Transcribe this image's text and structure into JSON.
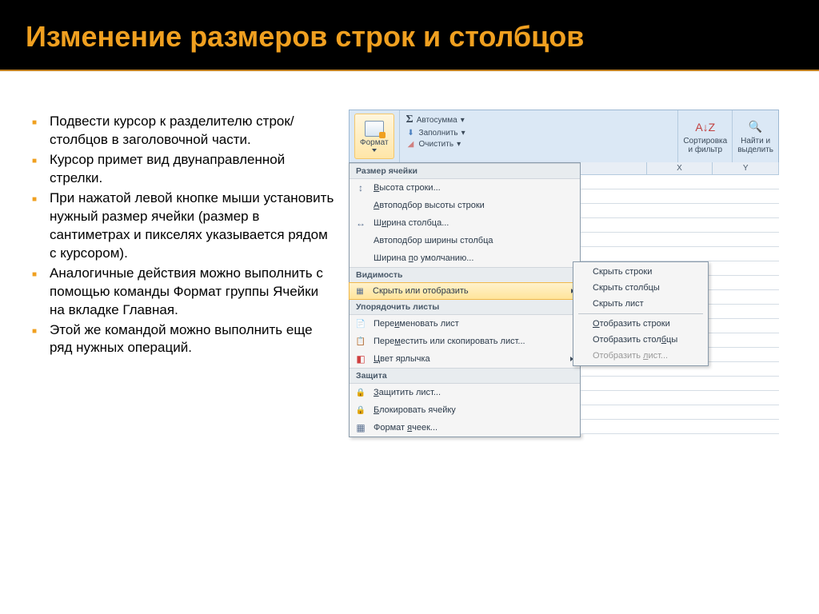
{
  "slide": {
    "title": "Изменение размеров строк и столбцов",
    "bullets": [
      "Подвести курсор к разделителю строк/столбцов в заголовочной части.",
      "Курсор примет вид двунаправленной стрелки.",
      "При нажатой левой кнопке мыши установить нужный размер ячейки (размер в сантиметрах и пикселях указывается рядом с курсором).",
      "Аналогичные действия можно выполнить с помощью команды Формат группы Ячейки на вкладке Главная.",
      "Этой же командой можно выполнить еще ряд нужных операций."
    ]
  },
  "ribbon": {
    "format_label": "Формат",
    "autosum": "Автосумма",
    "fill": "Заполнить",
    "clear": "Очистить",
    "sort_label1": "Сортировка",
    "sort_label2": "и фильтр",
    "find_label1": "Найти и",
    "find_label2": "выделить"
  },
  "menu": {
    "sections": {
      "cell_size": "Размер ячейки",
      "visibility": "Видимость",
      "sheets": "Упорядочить листы",
      "protection": "Защита"
    },
    "items": {
      "row_height": "Высота строки...",
      "auto_row": "Автоподбор высоты строки",
      "col_width": "Ширина столбца...",
      "auto_col": "Автоподбор ширины столбца",
      "default_width": "Ширина по умолчанию...",
      "hide_show": "Скрыть или отобразить",
      "rename": "Переименовать лист",
      "move": "Переместить или скопировать лист...",
      "tab_color": "Цвет ярлычка",
      "protect": "Защитить лист...",
      "lock": "Блокировать ячейку",
      "format_cells": "Формат ячеек..."
    }
  },
  "submenu": {
    "hide_rows": "Скрыть строки",
    "hide_cols": "Скрыть столбцы",
    "hide_sheet": "Скрыть лист",
    "show_rows": "Отобразить строки",
    "show_cols": "Отобразить столбцы",
    "show_sheet": "Отобразить лист..."
  },
  "grid": {
    "cols": [
      "X",
      "Y"
    ]
  }
}
